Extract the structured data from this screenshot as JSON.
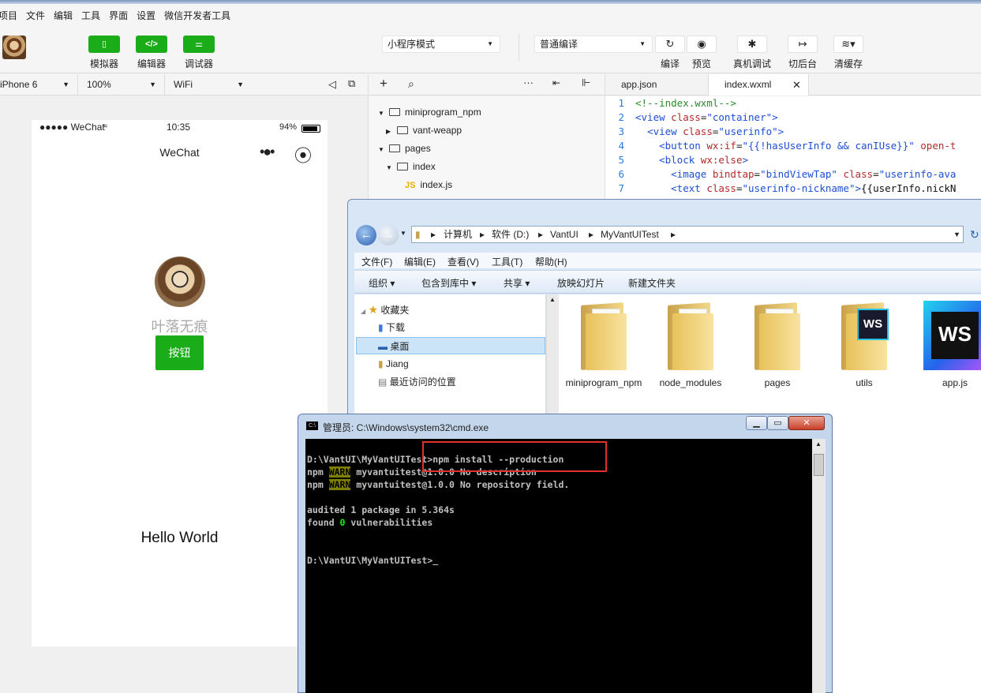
{
  "menu": [
    "项目",
    "文件",
    "编辑",
    "工具",
    "界面",
    "设置",
    "微信开发者工具"
  ],
  "toolbar": {
    "simulator": "模拟器",
    "editor": "编辑器",
    "debugger": "调试器",
    "mode_select": "小程序模式",
    "compile_select": "普通编译",
    "compile": "编译",
    "preview": "预览",
    "real_debug": "真机调试",
    "background": "切后台",
    "clear_cache": "清缓存"
  },
  "simbar": {
    "device": "iPhone 6",
    "zoom": "100%",
    "network": "WiFi"
  },
  "phone": {
    "signal": "●●●●● WeChat",
    "time": "10:35",
    "battery": "94%",
    "nav_title": "WeChat",
    "nickname": "叶落无痕",
    "button": "按钮",
    "hello": "Hello World"
  },
  "tree": [
    {
      "label": "miniprogram_npm",
      "type": "folder",
      "open": true
    },
    {
      "label": "vant-weapp",
      "type": "folder",
      "open": false
    },
    {
      "label": "pages",
      "type": "folder",
      "open": true
    },
    {
      "label": "index",
      "type": "folder",
      "open": true
    },
    {
      "label": "index.js",
      "type": "js"
    }
  ],
  "editor": {
    "tabs": [
      "app.json",
      "index.wxml"
    ],
    "active_tab": "index.wxml",
    "lines": [
      "1",
      "2",
      "3",
      "4",
      "5",
      "6",
      "7"
    ]
  },
  "explorer": {
    "path": [
      "计算机",
      "软件 (D:)",
      "VantUI",
      "MyVantUITest"
    ],
    "menu": [
      "文件(F)",
      "编辑(E)",
      "查看(V)",
      "工具(T)",
      "帮助(H)"
    ],
    "commands": [
      "组织 ▾",
      "包含到库中 ▾",
      "共享 ▾",
      "放映幻灯片",
      "新建文件夹"
    ],
    "nav": [
      "收藏夹",
      "下载",
      "桌面",
      "Jiang",
      "最近访问的位置"
    ],
    "selected_nav": "桌面",
    "items": [
      "miniprogram_npm",
      "node_modules",
      "pages",
      "utils",
      "app.js"
    ]
  },
  "cmd": {
    "title": "管理员: C:\\Windows\\system32\\cmd.exe",
    "lines": {
      "l1": "D:\\VantUI\\MyVantUITest>npm install --production",
      "l2_pre": "npm ",
      "warn": "WARN",
      "l2_post": " myvantuitest@1.0.0 No description",
      "l3_post": " myvantuitest@1.0.0 No repository field.",
      "l4": "audited 1 package in 5.364s",
      "l5_pre": "found ",
      "l5_num": "0",
      "l5_post": " vulnerabilities",
      "l6": "D:\\VantUI\\MyVantUITest>"
    }
  },
  "colors": {
    "wechat_green": "#1aad19",
    "highlight_red": "#e03030",
    "warn_bg": "#808000"
  }
}
